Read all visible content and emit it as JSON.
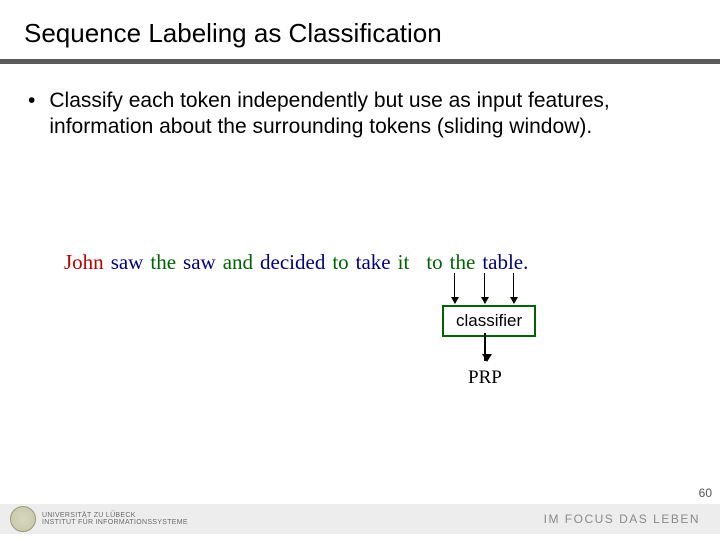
{
  "title": "Sequence Labeling as Classification",
  "bullet_text": "Classify each token independently but use as input features, information about the surrounding tokens (sliding window).",
  "sentence": [
    {
      "text": "John",
      "class": "red"
    },
    {
      "text": "saw",
      "class": "blue"
    },
    {
      "text": "the",
      "class": "green"
    },
    {
      "text": "saw",
      "class": "blue"
    },
    {
      "text": "and",
      "class": "green"
    },
    {
      "text": "decided",
      "class": "blue"
    },
    {
      "text": "to",
      "class": "green"
    },
    {
      "text": "take",
      "class": "blue"
    },
    {
      "text": "it",
      "class": "green"
    },
    {
      "text": "to",
      "class": "green"
    },
    {
      "text": "the",
      "class": "green"
    },
    {
      "text": "table.",
      "class": "blue"
    }
  ],
  "classifier_label": "classifier",
  "output_tag": "PRP",
  "footer": {
    "university_line1": "UNIVERSITÄT ZU LÜBECK",
    "university_line2": "INSTITUT FÜR INFORMATIONSSYSTEME",
    "tagline": "IM FOCUS DAS LEBEN"
  },
  "page_number": "60"
}
